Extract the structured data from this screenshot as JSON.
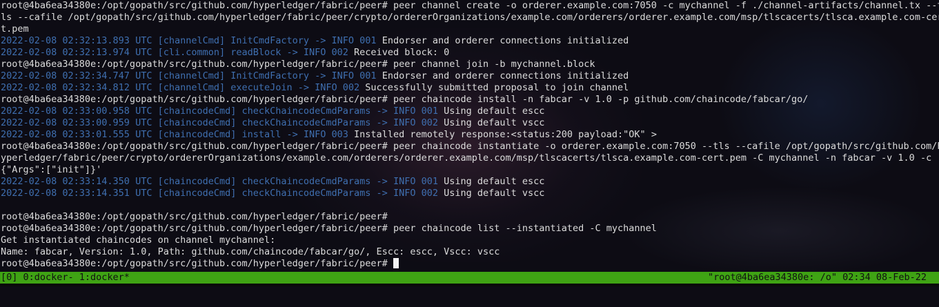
{
  "terminal": {
    "lines": [
      {
        "kind": "cmd",
        "text": "root@4ba6ea34380e:/opt/gopath/src/github.com/hyperledger/fabric/peer# peer channel create -o orderer.example.com:7050 -c mychannel -f ./channel-artifacts/channel.tx --t"
      },
      {
        "kind": "cmd",
        "text": "ls --cafile /opt/gopath/src/github.com/hyperledger/fabric/peer/crypto/ordererOrganizations/example.com/orderers/orderer.example.com/msp/tlscacerts/tlsca.example.com-cer"
      },
      {
        "kind": "cmd",
        "text": "t.pem"
      },
      {
        "kind": "log",
        "text": "2022-02-08 02:32:13.893 UTC [channelCmd] InitCmdFactory -> INFO 001",
        "msg": " Endorser and orderer connections initialized"
      },
      {
        "kind": "log",
        "text": "2022-02-08 02:32:13.974 UTC [cli.common] readBlock -> INFO 002",
        "msg": " Received block: 0"
      },
      {
        "kind": "cmd",
        "text": "root@4ba6ea34380e:/opt/gopath/src/github.com/hyperledger/fabric/peer# peer channel join -b mychannel.block"
      },
      {
        "kind": "log",
        "text": "2022-02-08 02:32:34.747 UTC [channelCmd] InitCmdFactory -> INFO 001",
        "msg": " Endorser and orderer connections initialized"
      },
      {
        "kind": "log",
        "text": "2022-02-08 02:32:34.812 UTC [channelCmd] executeJoin -> INFO 002",
        "msg": " Successfully submitted proposal to join channel"
      },
      {
        "kind": "cmd",
        "text": "root@4ba6ea34380e:/opt/gopath/src/github.com/hyperledger/fabric/peer# peer chaincode install -n fabcar -v 1.0 -p github.com/chaincode/fabcar/go/"
      },
      {
        "kind": "log",
        "text": "2022-02-08 02:33:00.958 UTC [chaincodeCmd] checkChaincodeCmdParams -> INFO 001",
        "msg": " Using default escc"
      },
      {
        "kind": "log",
        "text": "2022-02-08 02:33:00.959 UTC [chaincodeCmd] checkChaincodeCmdParams -> INFO 002",
        "msg": " Using default vscc"
      },
      {
        "kind": "log",
        "text": "2022-02-08 02:33:01.555 UTC [chaincodeCmd] install -> INFO 003",
        "msg": " Installed remotely response:<status:200 payload:\"OK\" >"
      },
      {
        "kind": "cmd",
        "text": "root@4ba6ea34380e:/opt/gopath/src/github.com/hyperledger/fabric/peer# peer chaincode instantiate -o orderer.example.com:7050 --tls --cafile /opt/gopath/src/github.com/h"
      },
      {
        "kind": "cmd",
        "text": "yperledger/fabric/peer/crypto/ordererOrganizations/example.com/orderers/orderer.example.com/msp/tlscacerts/tlsca.example.com-cert.pem -C mychannel -n fabcar -v 1.0 -c '"
      },
      {
        "kind": "cmd",
        "text": "{\"Args\":[\"init\"]}'"
      },
      {
        "kind": "log",
        "text": "2022-02-08 02:33:14.350 UTC [chaincodeCmd] checkChaincodeCmdParams -> INFO 001",
        "msg": " Using default escc"
      },
      {
        "kind": "log",
        "text": "2022-02-08 02:33:14.351 UTC [chaincodeCmd] checkChaincodeCmdParams -> INFO 002",
        "msg": " Using default vscc"
      },
      {
        "kind": "blank",
        "text": ""
      },
      {
        "kind": "cmd",
        "text": "root@4ba6ea34380e:/opt/gopath/src/github.com/hyperledger/fabric/peer#"
      },
      {
        "kind": "cmd",
        "text": "root@4ba6ea34380e:/opt/gopath/src/github.com/hyperledger/fabric/peer# peer chaincode list --instantiated -C mychannel"
      },
      {
        "kind": "cmd",
        "text": "Get instantiated chaincodes on channel mychannel:"
      },
      {
        "kind": "cmd",
        "text": "Name: fabcar, Version: 1.0, Path: github.com/chaincode/fabcar/go/, Escc: escc, Vscc: vscc"
      },
      {
        "kind": "prompt",
        "text": "root@4ba6ea34380e:/opt/gopath/src/github.com/hyperledger/fabric/peer# "
      }
    ]
  },
  "status_bar": {
    "left": "[0] 0:docker- 1:docker*",
    "right": "\"root@4ba6ea34380e: /o\" 02:34 08-Feb-22"
  },
  "colors": {
    "log": "#3f6fb0",
    "text": "#dcdcdc",
    "status_bar": "#3fa314"
  }
}
